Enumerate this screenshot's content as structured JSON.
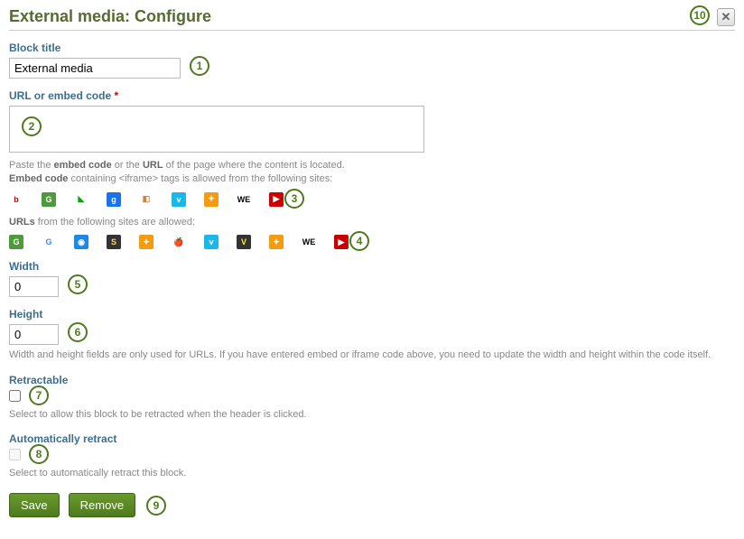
{
  "header": {
    "title": "External media: Configure",
    "close_glyph": "✕"
  },
  "block_title": {
    "label": "Block title",
    "value": "External media"
  },
  "url_embed": {
    "label": "URL or embed code",
    "required_marker": "*",
    "value": "",
    "help_prefix": "Paste the ",
    "help_embed": "embed code",
    "help_or": " or the ",
    "help_url": "URL",
    "help_suffix": " of the page where the content is located.",
    "help_embed_line_before": "Embed code",
    "help_embed_line_after": " containing <iframe> tags is allowed from the following sites:"
  },
  "embed_sites": [
    {
      "bg": "#fff",
      "fg": "#d00",
      "glyph": "b"
    },
    {
      "bg": "#4e9a3a",
      "fg": "#fff",
      "glyph": "G"
    },
    {
      "bg": "#fff",
      "fg": "#0a0",
      "glyph": "◣"
    },
    {
      "bg": "#1a73e8",
      "fg": "#fff",
      "glyph": "g"
    },
    {
      "bg": "#fff",
      "fg": "#e67e22",
      "glyph": "◧"
    },
    {
      "bg": "#1ab7ea",
      "fg": "#fff",
      "glyph": "v"
    },
    {
      "bg": "#f39c12",
      "fg": "#fff",
      "glyph": "✦"
    },
    {
      "bg": "#fff",
      "fg": "#000",
      "glyph": "WE"
    },
    {
      "bg": "#c00",
      "fg": "#fff",
      "glyph": "▶"
    }
  ],
  "urls_help_before": "URLs",
  "urls_help_after": " from the following sites are allowed:",
  "url_sites": [
    {
      "bg": "#4e9a3a",
      "fg": "#fff",
      "glyph": "G"
    },
    {
      "bg": "#fff",
      "fg": "#4285f4",
      "glyph": "G"
    },
    {
      "bg": "#1e88e5",
      "fg": "#fff",
      "glyph": "◉"
    },
    {
      "bg": "#333",
      "fg": "#ffd54f",
      "glyph": "S"
    },
    {
      "bg": "#f39c12",
      "fg": "#fff",
      "glyph": "✦"
    },
    {
      "bg": "#fff",
      "fg": "#c00",
      "glyph": "🍎"
    },
    {
      "bg": "#1ab7ea",
      "fg": "#fff",
      "glyph": "v"
    },
    {
      "bg": "#333",
      "fg": "#ffeb3b",
      "glyph": "V"
    },
    {
      "bg": "#f39c12",
      "fg": "#fff",
      "glyph": "✦"
    },
    {
      "bg": "#fff",
      "fg": "#000",
      "glyph": "WE"
    },
    {
      "bg": "#c00",
      "fg": "#fff",
      "glyph": "▶"
    }
  ],
  "width": {
    "label": "Width",
    "value": "0"
  },
  "height": {
    "label": "Height",
    "value": "0",
    "help": "Width and height fields are only used for URLs. If you have entered embed or iframe code above, you need to update the width and height within the code itself."
  },
  "retractable": {
    "label": "Retractable",
    "checked": false,
    "help": "Select to allow this block to be retracted when the header is clicked."
  },
  "auto_retract": {
    "label": "Automatically retract",
    "checked": false,
    "disabled": true,
    "help": "Select to automatically retract this block."
  },
  "buttons": {
    "save": "Save",
    "remove": "Remove"
  },
  "annotations": {
    "1": "1",
    "2": "2",
    "3": "3",
    "4": "4",
    "5": "5",
    "6": "6",
    "7": "7",
    "8": "8",
    "9": "9",
    "10": "10"
  }
}
